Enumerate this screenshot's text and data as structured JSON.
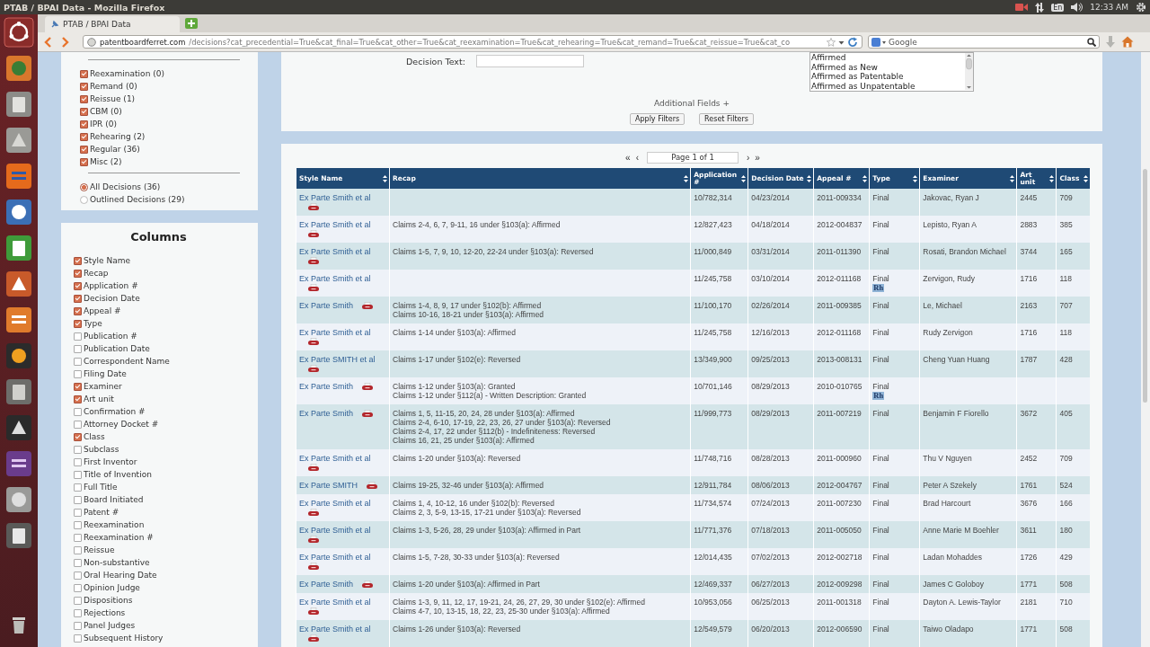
{
  "os_bar": {
    "title": "PTAB / BPAI Data - Mozilla Firefox",
    "keyboard": "En",
    "time": "12:33 AM"
  },
  "browser": {
    "tabs": [
      {
        "title": "PTAB / BPAI Data",
        "selected": true
      }
    ],
    "url_host": "patentboardferret.com",
    "url_path": "/decisions?cat_precedential=True&cat_final=True&cat_other=True&cat_reexamination=True&cat_rehearing=True&cat_remand=True&cat_reissue=True&cat_co",
    "search_placeholder": "Google"
  },
  "category_filters": [
    {
      "label": "Reexamination (0)",
      "checked": true
    },
    {
      "label": "Remand (0)",
      "checked": true
    },
    {
      "label": "Reissue (1)",
      "checked": true
    },
    {
      "label": "CBM (0)",
      "checked": true
    },
    {
      "label": "IPR (0)",
      "checked": true
    },
    {
      "label": "Rehearing (2)",
      "checked": true
    },
    {
      "label": "Regular (36)",
      "checked": true
    },
    {
      "label": "Misc (2)",
      "checked": true
    }
  ],
  "decision_scope": [
    {
      "label": "All Decisions (36)",
      "selected": true
    },
    {
      "label": "Outlined Decisions (29)",
      "selected": false
    }
  ],
  "columns_panel": {
    "title": "Columns",
    "items": [
      {
        "label": "Style Name",
        "checked": true
      },
      {
        "label": "Recap",
        "checked": true
      },
      {
        "label": "Application #",
        "checked": true
      },
      {
        "label": "Decision Date",
        "checked": true
      },
      {
        "label": "Appeal #",
        "checked": true
      },
      {
        "label": "Type",
        "checked": true
      },
      {
        "label": "Publication #",
        "checked": false
      },
      {
        "label": "Publication Date",
        "checked": false
      },
      {
        "label": "Correspondent Name",
        "checked": false
      },
      {
        "label": "Filing Date",
        "checked": false
      },
      {
        "label": "Examiner",
        "checked": true
      },
      {
        "label": "Art unit",
        "checked": true
      },
      {
        "label": "Confirmation #",
        "checked": false
      },
      {
        "label": "Attorney Docket #",
        "checked": false
      },
      {
        "label": "Class",
        "checked": true
      },
      {
        "label": "Subclass",
        "checked": false
      },
      {
        "label": "First Inventor",
        "checked": false
      },
      {
        "label": "Title of Invention",
        "checked": false
      },
      {
        "label": "Full Title",
        "checked": false
      },
      {
        "label": "Board Initiated",
        "checked": false
      },
      {
        "label": "Patent #",
        "checked": false
      },
      {
        "label": "Reexamination",
        "checked": false
      },
      {
        "label": "Reexamination #",
        "checked": false
      },
      {
        "label": "Reissue",
        "checked": false
      },
      {
        "label": "Non-substantive",
        "checked": false
      },
      {
        "label": "Oral Hearing Date",
        "checked": false
      },
      {
        "label": "Opinion Judge",
        "checked": false
      },
      {
        "label": "Dispositions",
        "checked": false
      },
      {
        "label": "Rejections",
        "checked": false
      },
      {
        "label": "Panel Judges",
        "checked": false
      },
      {
        "label": "Subsequent History",
        "checked": false
      }
    ]
  },
  "filter_panel": {
    "decision_text_label": "Decision Text:",
    "dispositions": [
      {
        "label": "Affirmed",
        "selected": false
      },
      {
        "label": "Affirmed as New",
        "selected": false
      },
      {
        "label": "Affirmed as Patentable",
        "selected": false
      },
      {
        "label": "Affirmed as Unpatentable",
        "selected": false
      }
    ],
    "additional_fields": "Additional Fields +",
    "buttons": [
      "Apply Filters",
      "Reset Filters"
    ]
  },
  "pagination": {
    "first": "«",
    "prev": "‹",
    "page": "Page 1 of 1",
    "next": "›",
    "last": "»"
  },
  "table": {
    "columns": [
      "Style Name",
      "Recap",
      "Application #",
      "Decision Date",
      "Appeal #",
      "Type",
      "Examiner",
      "Art unit",
      "Class"
    ],
    "rows": [
      {
        "style_name": "Ex Parte Smith et al",
        "application": "10/782,314",
        "decision_date": "04/23/2014",
        "appeal": "2011-009334",
        "type": "Final",
        "examiner": "Jakovac, Ryan J",
        "art_unit": "2445",
        "class": "709"
      },
      {
        "style_name": "Ex Parte Smith et al",
        "recap": [
          "Claims 2-4, 6, 7, 9-11, 16 under §103(a): Affirmed"
        ],
        "application": "12/827,423",
        "decision_date": "04/18/2014",
        "appeal": "2012-004837",
        "type": "Final",
        "examiner": "Lepisto, Ryan A",
        "art_unit": "2883",
        "class": "385"
      },
      {
        "style_name": "Ex Parte Smith et al",
        "recap": [
          "Claims 1-5, 7, 9, 10, 12-20, 22-24 under §103(a): Reversed"
        ],
        "application": "11/000,849",
        "decision_date": "03/31/2014",
        "appeal": "2011-011390",
        "type": "Final",
        "examiner": "Rosati, Brandon Michael",
        "art_unit": "3744",
        "class": "165"
      },
      {
        "style_name": "Ex Parte Smith et al",
        "application": "11/245,758",
        "decision_date": "03/10/2014",
        "appeal": "2012-011168",
        "type": "Final",
        "badge": "Rh",
        "examiner": "Zervigon, Rudy",
        "art_unit": "1716",
        "class": "118"
      },
      {
        "style_name": "Ex Parte Smith",
        "recap": [
          "Claims 1-4, 8, 9, 17 under §102(b): Affirmed",
          "Claims 10-16, 18-21 under §103(a): Affirmed"
        ],
        "application": "11/100,170",
        "decision_date": "02/26/2014",
        "appeal": "2011-009385",
        "type": "Final",
        "examiner": "Le, Michael",
        "art_unit": "2163",
        "class": "707"
      },
      {
        "style_name": "Ex Parte Smith et al",
        "recap": [
          "Claims 1-14 under §103(a): Affirmed"
        ],
        "application": "11/245,758",
        "decision_date": "12/16/2013",
        "appeal": "2012-011168",
        "type": "Final",
        "examiner": "Rudy Zervigon",
        "art_unit": "1716",
        "class": "118"
      },
      {
        "style_name": "Ex Parte SMITH et al",
        "recap": [
          "Claims 1-17 under §102(e): Reversed"
        ],
        "application": "13/349,900",
        "decision_date": "09/25/2013",
        "appeal": "2013-008131",
        "type": "Final",
        "examiner": "Cheng Yuan Huang",
        "art_unit": "1787",
        "class": "428"
      },
      {
        "style_name": "Ex Parte Smith",
        "recap": [
          "Claims 1-12 under §103(a): Granted",
          "Claims 1-12 under §112(a) - Written Description: Granted"
        ],
        "application": "10/701,146",
        "decision_date": "08/29/2013",
        "appeal": "2010-010765",
        "type": "Final",
        "badge": "Rh"
      },
      {
        "style_name": "Ex Parte Smith",
        "recap": [
          "Claims 1, 5, 11-15, 20, 24, 28 under §103(a): Affirmed",
          "Claims 2-4, 6-10, 17-19, 22, 23, 26, 27 under §103(a): Reversed",
          "Claims 2-4, 17, 22 under §112(b) - Indefiniteness: Reversed",
          "Claims 16, 21, 25 under §103(a): Affirmed"
        ],
        "application": "11/999,773",
        "decision_date": "08/29/2013",
        "appeal": "2011-007219",
        "type": "Final",
        "examiner": "Benjamin F Fiorello",
        "art_unit": "3672",
        "class": "405"
      },
      {
        "style_name": "Ex Parte Smith et al",
        "recap": [
          "Claims 1-20 under §103(a): Reversed"
        ],
        "application": "11/748,716",
        "decision_date": "08/28/2013",
        "appeal": "2011-000960",
        "type": "Final",
        "examiner": "Thu V Nguyen",
        "art_unit": "2452",
        "class": "709"
      },
      {
        "style_name": "Ex Parte SMITH",
        "recap": [
          "Claims 19-25, 32-46 under §103(a): Affirmed"
        ],
        "application": "12/911,784",
        "decision_date": "08/06/2013",
        "appeal": "2012-004767",
        "type": "Final",
        "examiner": "Peter A Szekely",
        "art_unit": "1761",
        "class": "524"
      },
      {
        "style_name": "Ex Parte Smith et al",
        "recap": [
          "Claims 1, 4, 10-12, 16 under §102(b): Reversed",
          "Claims 2, 3, 5-9, 13-15, 17-21 under §103(a): Reversed"
        ],
        "application": "11/734,574",
        "decision_date": "07/24/2013",
        "appeal": "2011-007230",
        "type": "Final",
        "examiner": "Brad Harcourt",
        "art_unit": "3676",
        "class": "166"
      },
      {
        "style_name": "Ex Parte Smith et al",
        "recap": [
          "Claims 1-3, 5-26, 28, 29 under §103(a): Affirmed in Part"
        ],
        "application": "11/771,376",
        "decision_date": "07/18/2013",
        "appeal": "2011-005050",
        "type": "Final",
        "examiner": "Anne Marie M Boehler",
        "art_unit": "3611",
        "class": "180"
      },
      {
        "style_name": "Ex Parte Smith et al",
        "recap": [
          "Claims 1-5, 7-28, 30-33 under §103(a): Reversed"
        ],
        "application": "12/014,435",
        "decision_date": "07/02/2013",
        "appeal": "2012-002718",
        "type": "Final",
        "examiner": "Ladan Mohaddes",
        "art_unit": "1726",
        "class": "429"
      },
      {
        "style_name": "Ex Parte Smith",
        "recap": [
          "Claims 1-20 under §103(a): Affirmed in Part"
        ],
        "application": "12/469,337",
        "decision_date": "06/27/2013",
        "appeal": "2012-009298",
        "type": "Final",
        "examiner": "James C Goloboy",
        "art_unit": "1771",
        "class": "508"
      },
      {
        "style_name": "Ex Parte Smith et al",
        "recap": [
          "Claims 1-3, 9, 11, 12, 17, 19-21, 24, 26, 27, 29, 30 under §102(e): Affirmed",
          "Claims 4-7, 10, 13-15, 18, 22, 23, 25-30 under §103(a): Affirmed"
        ],
        "application": "10/953,056",
        "decision_date": "06/25/2013",
        "appeal": "2011-001318",
        "type": "Final",
        "examiner": "Dayton A. Lewis-Taylor",
        "art_unit": "2181",
        "class": "710"
      },
      {
        "style_name": "Ex Parte Smith et al",
        "recap": [
          "Claims 1-26 under §103(a): Reversed"
        ],
        "application": "12/549,579",
        "decision_date": "06/20/2013",
        "appeal": "2012-006590",
        "type": "Final",
        "examiner": "Taiwo Oladapo",
        "art_unit": "1771",
        "class": "508"
      }
    ]
  }
}
